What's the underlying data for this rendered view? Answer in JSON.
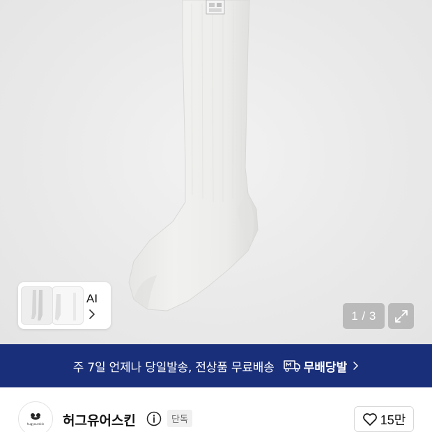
{
  "gallery": {
    "ai_label": "AI",
    "page_counter": "1 / 3",
    "product_image": "white knee-high sock"
  },
  "shipping_banner": {
    "text": "주 7일 언제나 당일발송, 전상품 무료배송",
    "badge_label": "무배당발",
    "badge_icon": "truck-m-icon",
    "background": "#1a2f7a"
  },
  "brand": {
    "logo_caption": "hugyourskin",
    "name": "허그유어스킨",
    "exclusive_badge": "단독",
    "likes": "15만"
  }
}
